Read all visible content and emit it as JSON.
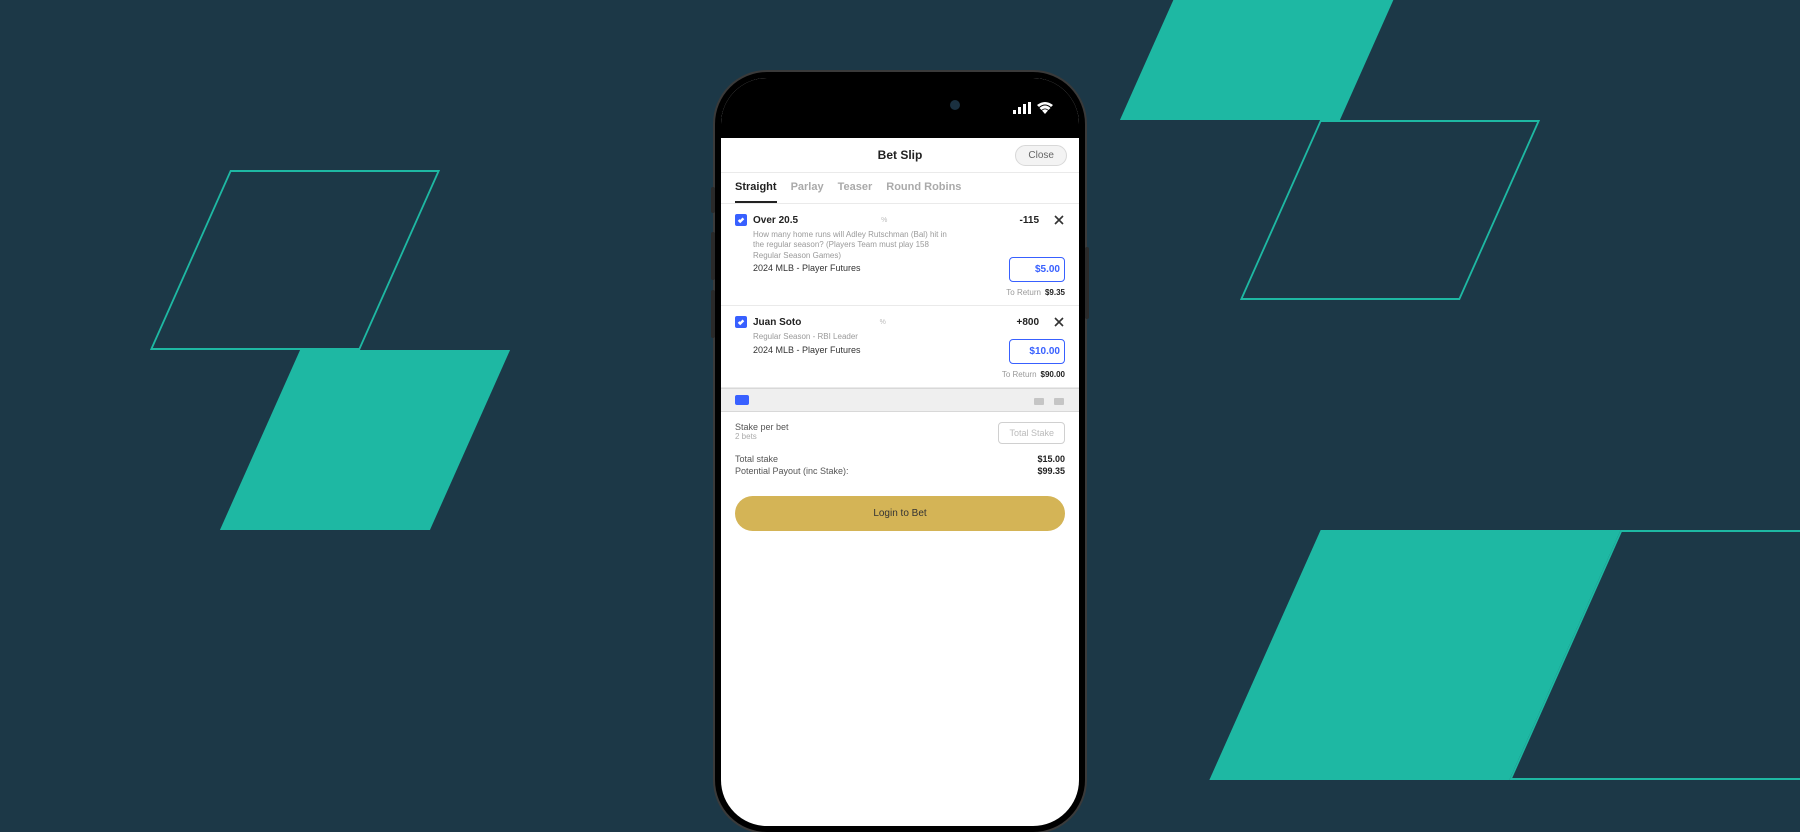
{
  "header": {
    "title": "Bet Slip",
    "close": "Close"
  },
  "tabs": [
    "Straight",
    "Parlay",
    "Teaser",
    "Round Robins"
  ],
  "bets": [
    {
      "title": "Over 20.5",
      "odds": "-115",
      "desc": "How many home runs will Adley Rutschman (Bal) hit in the regular season? (Players Team must play 158 Regular Season Games)",
      "league": "2024 MLB - Player Futures",
      "stake": "$5.00",
      "return_label": "To Return",
      "return_val": "$9.35"
    },
    {
      "title": "Juan Soto",
      "odds": "+800",
      "desc": "Regular Season - RBI Leader",
      "league": "2024 MLB - Player Futures",
      "stake": "$10.00",
      "return_label": "To Return",
      "return_val": "$90.00"
    }
  ],
  "summary": {
    "stake_per_bet": "Stake per bet",
    "bet_count": "2 bets",
    "total_stake_btn": "Total Stake",
    "total_stake_label": "Total stake",
    "total_stake_val": "$15.00",
    "payout_label": "Potential Payout (inc Stake):",
    "payout_val": "$99.35"
  },
  "cta": "Login to Bet"
}
